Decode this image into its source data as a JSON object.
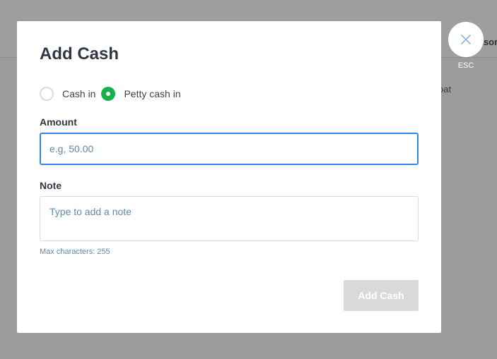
{
  "background": {
    "header_text_fragment": "nsor",
    "row_text_fragment": "oat"
  },
  "close": {
    "icon": "close-icon",
    "label": "ESC"
  },
  "modal": {
    "title": "Add Cash",
    "radio_options": [
      {
        "label": "Cash in",
        "checked": false
      },
      {
        "label": "Petty cash in",
        "checked": true
      }
    ],
    "amount": {
      "label": "Amount",
      "value": "",
      "placeholder": "e.g, 50.00"
    },
    "note": {
      "label": "Note",
      "value": "",
      "placeholder": "Type to add a note",
      "hint": "Max characters: 255"
    },
    "submit_label": "Add Cash"
  },
  "colors": {
    "accent_green": "#17b04a",
    "focus_blue": "#2f86e6",
    "disabled_button": "#d8d9db"
  }
}
